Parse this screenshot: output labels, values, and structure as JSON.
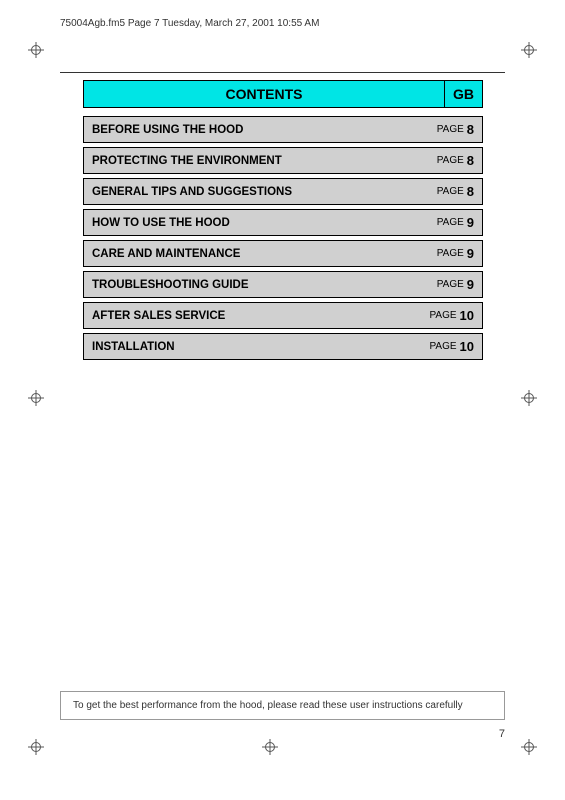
{
  "header": {
    "filename": "75004Agb.fm5  Page 7  Tuesday, March 27, 2001  10:55 AM"
  },
  "contents": {
    "title": "CONTENTS",
    "gb_label": "GB"
  },
  "table_rows": [
    {
      "label": "BEFORE USING THE HOOD",
      "page_word": "PAGE",
      "page_num": "8"
    },
    {
      "label": "PROTECTING THE ENVIRONMENT",
      "page_word": "PAGE",
      "page_num": "8"
    },
    {
      "label": "GENERAL TIPS AND SUGGESTIONS",
      "page_word": "PAGE",
      "page_num": "8"
    },
    {
      "label": "HOW TO USE THE HOOD",
      "page_word": "PAGE",
      "page_num": "9"
    },
    {
      "label": "CARE AND MAINTENANCE",
      "page_word": "PAGE",
      "page_num": "9"
    },
    {
      "label": "TROUBLESHOOTING GUIDE",
      "page_word": "PAGE",
      "page_num": "9"
    },
    {
      "label": "AFTER SALES SERVICE",
      "page_word": "PAGE",
      "page_num": "10"
    },
    {
      "label": "INSTALLATION",
      "page_word": "PAGE",
      "page_num": "10"
    }
  ],
  "footer": {
    "note": "To get the best performance from the hood, please read these user instructions carefully"
  },
  "page_number": "7"
}
